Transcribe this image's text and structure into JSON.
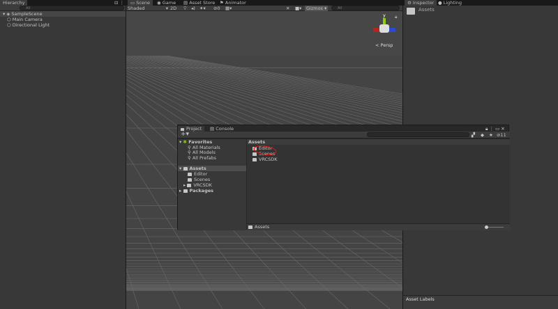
{
  "hierarchy": {
    "title": "Hierarchy",
    "search_placeholder": "All",
    "scene": "SampleScene",
    "items": [
      "Main Camera",
      "Directional Light"
    ]
  },
  "scene_tabs": [
    "Scene",
    "Game",
    "Asset Store",
    "Animator"
  ],
  "scene_toolbar": {
    "shading": "Shaded",
    "mode_2d": "2D",
    "gizmos": "Gizmos",
    "search_placeholder": "All",
    "layers_count": "0"
  },
  "gizmo": {
    "axis_y": "y",
    "persp": "Persp"
  },
  "inspector": {
    "tabs": [
      "Inspector",
      "Lighting"
    ],
    "title": "Assets",
    "asset_labels": "Asset Labels"
  },
  "project": {
    "tabs": [
      "Project",
      "Console"
    ],
    "add_label": "+",
    "favorites": {
      "label": "Favorites",
      "items": [
        "All Materials",
        "All Models",
        "All Prefabs"
      ]
    },
    "assets": {
      "label": "Assets",
      "children": [
        "Editor",
        "Scenes",
        "VRCSDK"
      ]
    },
    "packages": "Packages",
    "header": "Assets",
    "files": [
      "Editor",
      "Scenes",
      "VRCSDK"
    ],
    "footer_path": "Assets",
    "hidden_count": "11",
    "search_placeholder": ""
  }
}
